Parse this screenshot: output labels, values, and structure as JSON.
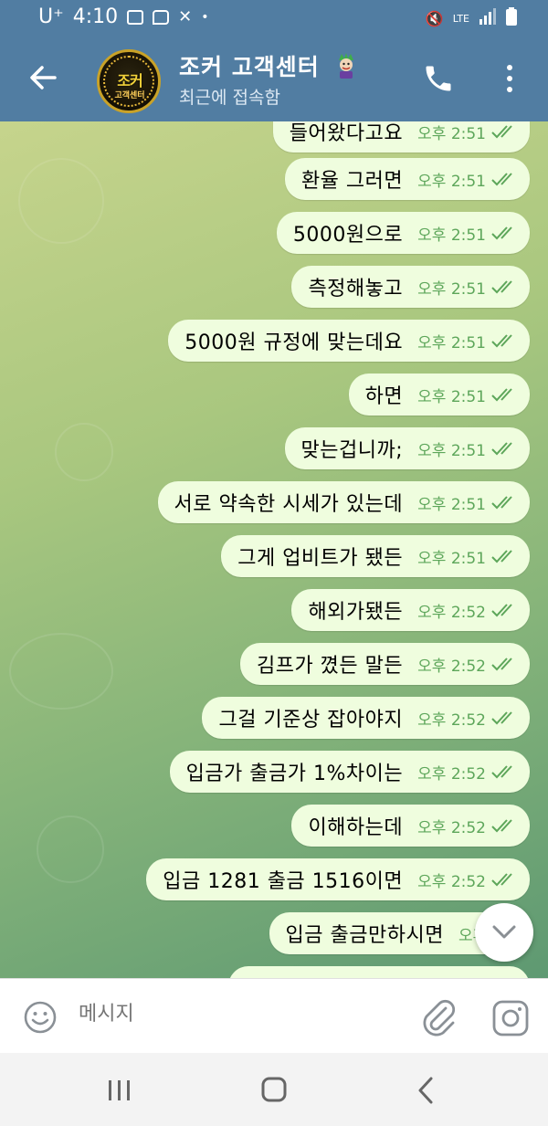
{
  "status_bar": {
    "carrier": "U⁺",
    "time": "4:10",
    "network": "LTE"
  },
  "header": {
    "title": "조커 고객센터",
    "subtitle": "최근에 접속함",
    "avatar_text": "조커",
    "avatar_subtext": "고객센터"
  },
  "messages": [
    {
      "text": "들어왔다고요",
      "time": "오후 2:51"
    },
    {
      "text": "환율 그러면",
      "time": "오후 2:51"
    },
    {
      "text": "5000원으로",
      "time": "오후 2:51"
    },
    {
      "text": "측정해놓고",
      "time": "오후 2:51"
    },
    {
      "text": "5000원 규정에 맞는데요",
      "time": "오후 2:51"
    },
    {
      "text": "하면",
      "time": "오후 2:51"
    },
    {
      "text": "맞는겁니까;",
      "time": "오후 2:51"
    },
    {
      "text": "서로 약속한 시세가 있는데",
      "time": "오후 2:51"
    },
    {
      "text": "그게 업비트가 됐든",
      "time": "오후 2:51"
    },
    {
      "text": "해외가됐든",
      "time": "오후 2:52"
    },
    {
      "text": "김프가 꼈든 말든",
      "time": "오후 2:52"
    },
    {
      "text": "그걸 기준상 잡아야지",
      "time": "오후 2:52"
    },
    {
      "text": "입금가 출금가 1%차이는",
      "time": "오후 2:52"
    },
    {
      "text": "이해하는데",
      "time": "오후 2:52"
    },
    {
      "text": "입금 1281 출금 1516이면",
      "time": "오후 2:52"
    },
    {
      "text": "입금 출금만하시면",
      "time": "오후 2:5"
    }
  ],
  "composer": {
    "placeholder": "메시지"
  },
  "colors": {
    "header": "#517DA2",
    "bubble": "#EFFDDE",
    "meta": "#5da65a"
  },
  "icons": {
    "back": "arrow-left-icon",
    "call": "phone-icon",
    "more": "more-vertical-icon",
    "emoji": "emoji-icon",
    "attach": "paperclip-icon",
    "camera": "instagram-camera-icon"
  }
}
